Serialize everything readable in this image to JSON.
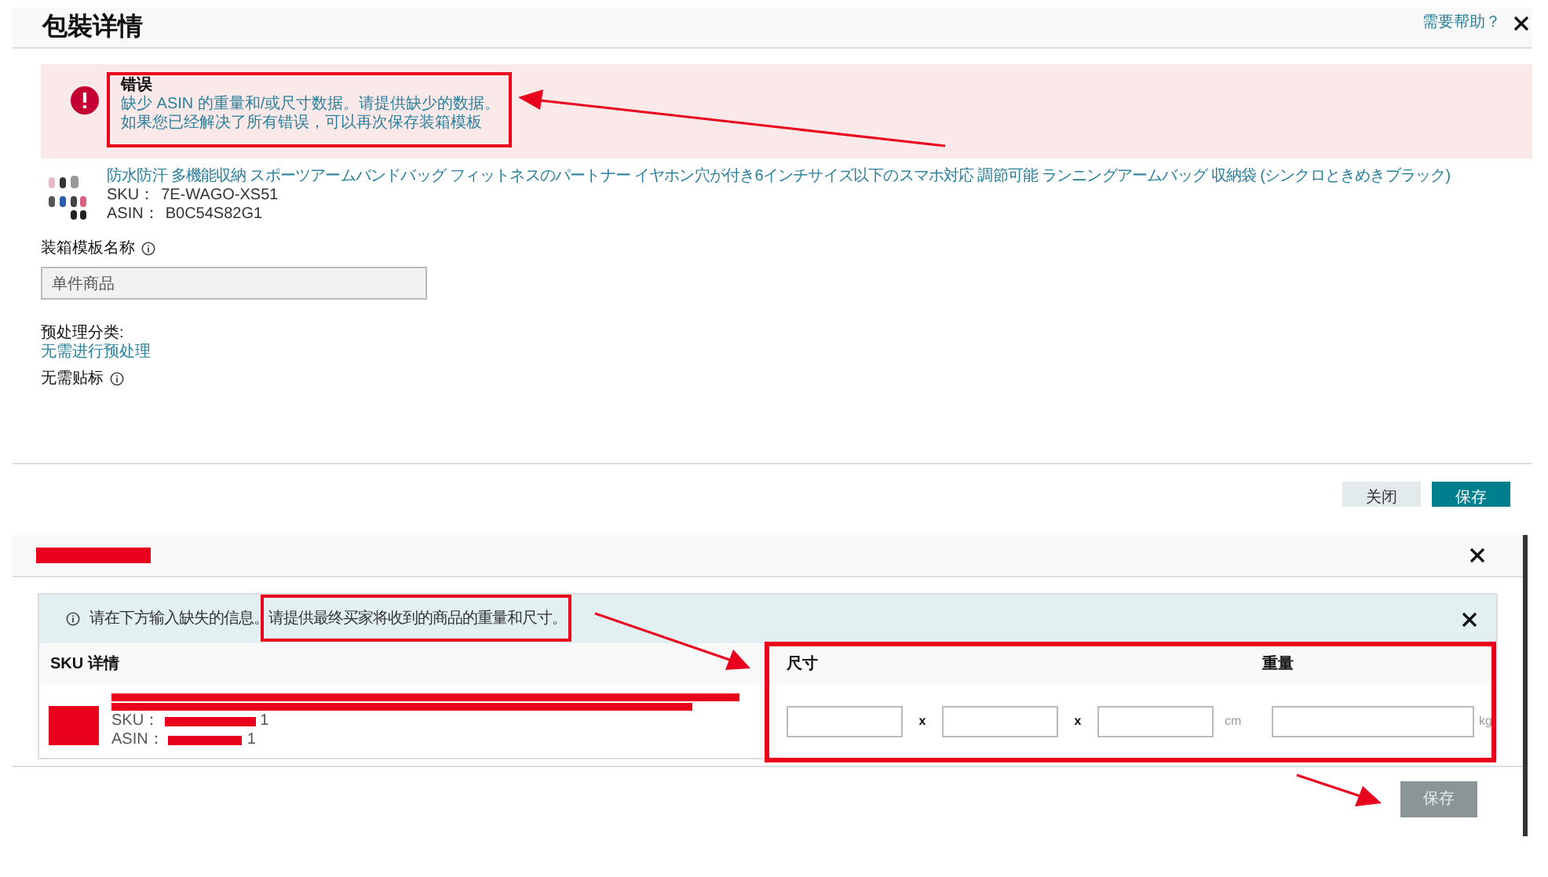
{
  "top_dialog": {
    "title": "包裝详情",
    "help_link": "需要帮助？",
    "error": {
      "title": "错误",
      "lines": [
        "缺少 ASIN 的重量和/或尺寸数据。请提供缺少的数据。",
        "如果您已经解决了所有错误，可以再次保存装箱模板"
      ]
    },
    "product": {
      "name": "防水防汗 多機能収納 スポーツアームバンドバッグ フィットネスのパートナー イヤホン穴が付き6インチサイズ以下のスマホ対応 調節可能 ランニングアームバッグ 収納袋 (シンクロときめきブラック)",
      "sku_label": "SKU：",
      "sku": "7E-WAGO-XS51",
      "asin_label": "ASIN：",
      "asin": "B0C54S82G1"
    },
    "template_name": {
      "label": "装箱模板名称",
      "value": "单件商品"
    },
    "prep": {
      "label": "预处理分类:",
      "value": "无需进行预处理"
    },
    "labeling": "无需贴标",
    "buttons": [
      {
        "label": "关闭",
        "kind": "secondary"
      },
      {
        "label": "保存",
        "kind": "primary"
      }
    ]
  },
  "bottom_dialog": {
    "info": "请在下方输入缺失的信息。请提供最终买家将收到的商品的重量和尺寸。",
    "columns": [
      "SKU 详情",
      "尺寸",
      "重量"
    ],
    "row": {
      "sku_label": "SKU：",
      "sku_visible": "1",
      "asin_label": "ASIN：",
      "asin_visible": "1"
    },
    "separators": [
      "x",
      "x"
    ],
    "dimension_unit": "cm",
    "weight_unit": "kg",
    "save": {
      "label": "保存",
      "disabled": true
    }
  }
}
